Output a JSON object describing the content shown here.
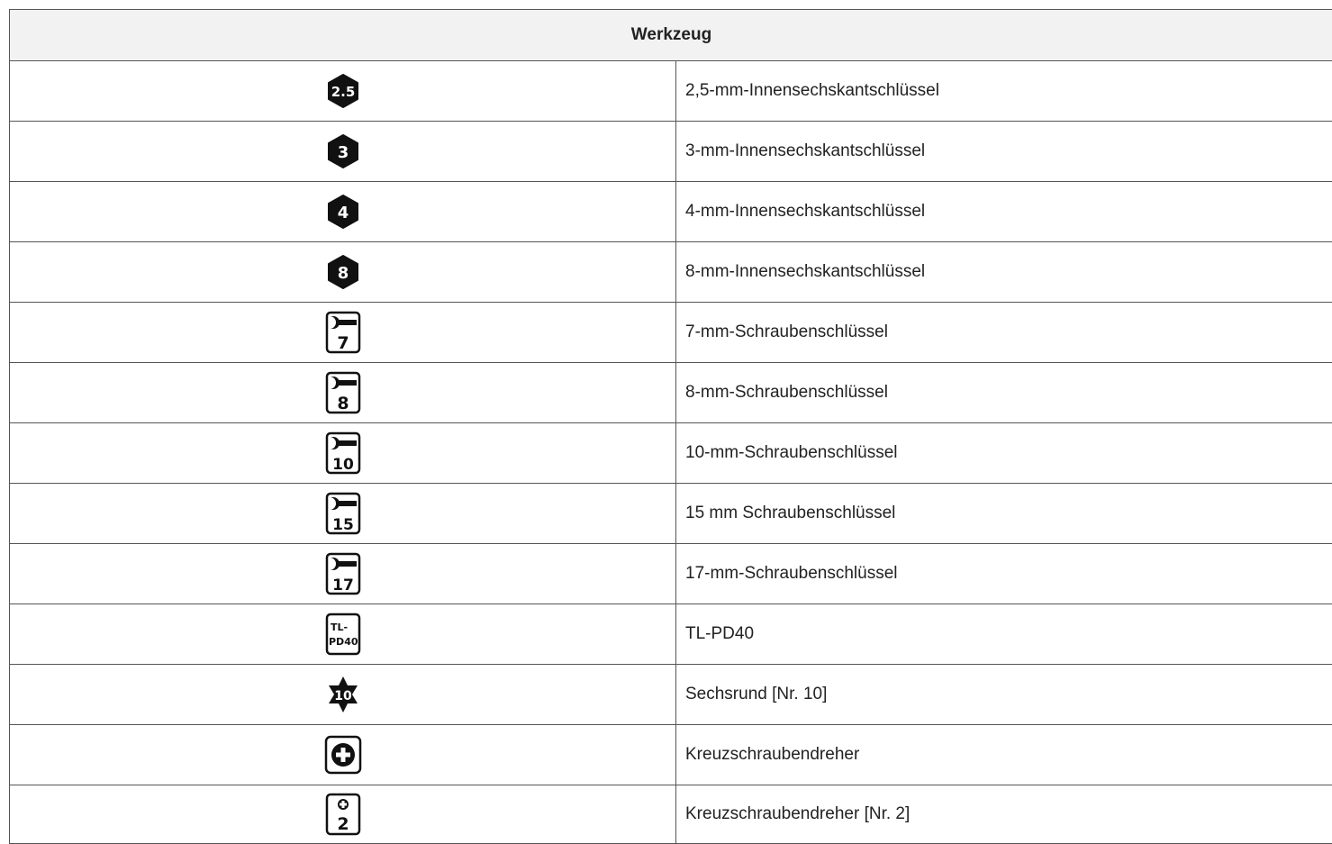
{
  "table": {
    "header": "Werkzeug",
    "rows": [
      {
        "icon": "hex-key-icon",
        "icon_text": "2.5",
        "label": "2,5-mm-Innensechskantschlüssel"
      },
      {
        "icon": "hex-key-icon",
        "icon_text": "3",
        "label": "3-mm-Innensechskantschlüssel"
      },
      {
        "icon": "hex-key-icon",
        "icon_text": "4",
        "label": "4-mm-Innensechskantschlüssel"
      },
      {
        "icon": "hex-key-icon",
        "icon_text": "8",
        "label": "8-mm-Innensechskantschlüssel"
      },
      {
        "icon": "wrench-icon",
        "icon_text": "7",
        "label": "7-mm-Schraubenschlüssel"
      },
      {
        "icon": "wrench-icon",
        "icon_text": "8",
        "label": "8-mm-Schraubenschlüssel"
      },
      {
        "icon": "wrench-icon",
        "icon_text": "10",
        "label": "10-mm-Schraubenschlüssel"
      },
      {
        "icon": "wrench-icon",
        "icon_text": "15",
        "label": "15 mm Schraubenschlüssel"
      },
      {
        "icon": "wrench-icon",
        "icon_text": "17",
        "label": "17-mm-Schraubenschlüssel"
      },
      {
        "icon": "special-tool-icon",
        "icon_text": "TL-\nPD40",
        "label": "TL-PD40"
      },
      {
        "icon": "torx-icon",
        "icon_text": "10",
        "label": "Sechsrund [Nr. 10]"
      },
      {
        "icon": "phillips-screwdriver-icon",
        "icon_text": "",
        "label": "Kreuzschraubendreher"
      },
      {
        "icon": "phillips-screwdriver-icon",
        "icon_text": "2",
        "label": "Kreuzschraubendreher [Nr. 2]"
      }
    ]
  }
}
